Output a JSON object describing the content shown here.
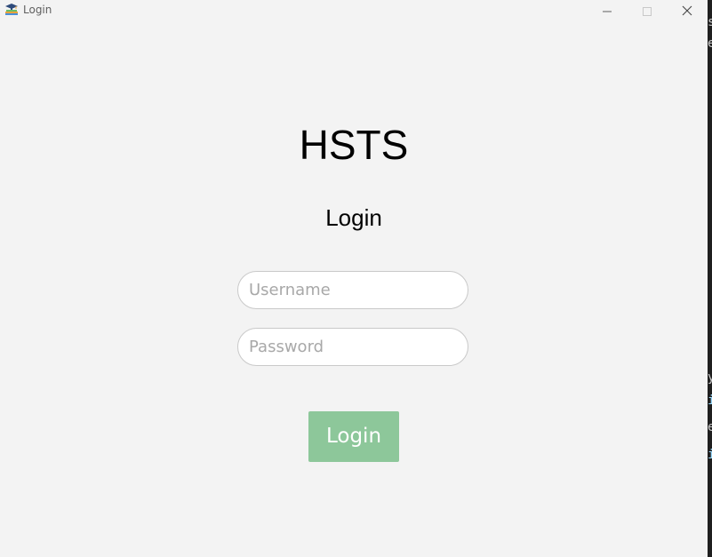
{
  "window": {
    "title": "Login",
    "icon": "graduation-cap-books-icon",
    "controls": {
      "minimize_icon": "minimize-icon",
      "maximize_icon": "maximize-icon",
      "close_icon": "close-icon"
    }
  },
  "main": {
    "app_title": "HSTS",
    "heading": "Login",
    "username": {
      "placeholder": "Username",
      "value": ""
    },
    "password": {
      "placeholder": "Password",
      "value": ""
    },
    "login_button": {
      "label": "Login",
      "color": "#8dc79a"
    }
  },
  "colors": {
    "window_background": "#f3f3f3",
    "field_border": "#c9c9c9",
    "button_text": "#ffffff"
  }
}
